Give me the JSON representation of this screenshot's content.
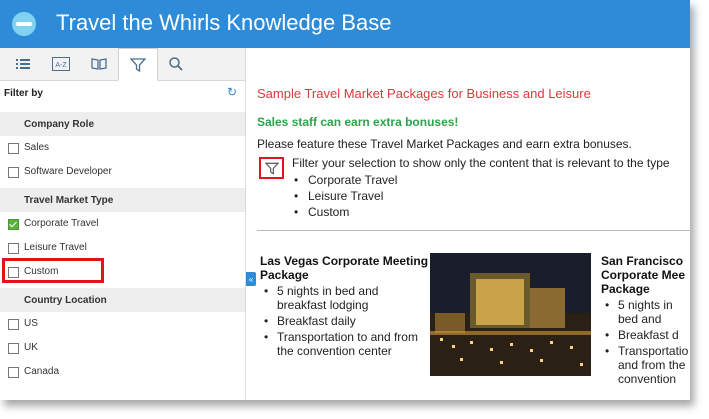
{
  "header": {
    "title": "Travel the Whirls Knowledge Base",
    "color": "#2d8bd8"
  },
  "sidebar": {
    "tabs": [
      {
        "icon": "list-icon"
      },
      {
        "icon": "a-z-index-icon",
        "label": "A-Z"
      },
      {
        "icon": "book-icon"
      },
      {
        "icon": "filter-icon",
        "active": true
      },
      {
        "icon": "search-icon"
      }
    ],
    "filter_label": "Filter by",
    "groups": [
      {
        "title": "Company Role",
        "options": [
          {
            "label": "Sales",
            "checked": false
          },
          {
            "label": "Software Developer",
            "checked": false
          }
        ]
      },
      {
        "title": "Travel Market Type",
        "options": [
          {
            "label": "Corporate Travel",
            "checked": true
          },
          {
            "label": "Leisure Travel",
            "checked": false
          },
          {
            "label": "Custom",
            "checked": false
          }
        ]
      },
      {
        "title": "Country Location",
        "options": [
          {
            "label": "US",
            "checked": false
          },
          {
            "label": "UK",
            "checked": false
          },
          {
            "label": "Canada",
            "checked": false
          }
        ]
      }
    ]
  },
  "main": {
    "heading": "Sample Travel Market Packages for Business and Leisure",
    "subheading": "Sales staff can earn extra bonuses!",
    "intro": "Please feature these Travel Market Packages and earn extra bonuses.",
    "filter_text": "Filter your selection to show only the content that is relevant to the type",
    "types": [
      "Corporate Travel",
      "Leisure Travel",
      "Custom"
    ],
    "cards": [
      {
        "title": "Las Vegas Corporate Meeting Package",
        "bullets": [
          "5 nights in bed and breakfast lodging",
          "Breakfast daily",
          "Transportation to and from the convention center"
        ]
      },
      {
        "title_lines": [
          "San Francisco",
          "Corporate Mee",
          "Package"
        ],
        "bullets": [
          "5 nights in",
          "bed and",
          "Breakfast d",
          "Transportatio",
          "and from the",
          "convention"
        ]
      }
    ]
  },
  "colors": {
    "accent_red": "#e0141c",
    "heading_red": "#d83b3b",
    "heading_green": "#2fa34a",
    "check_green": "#5fb043"
  }
}
